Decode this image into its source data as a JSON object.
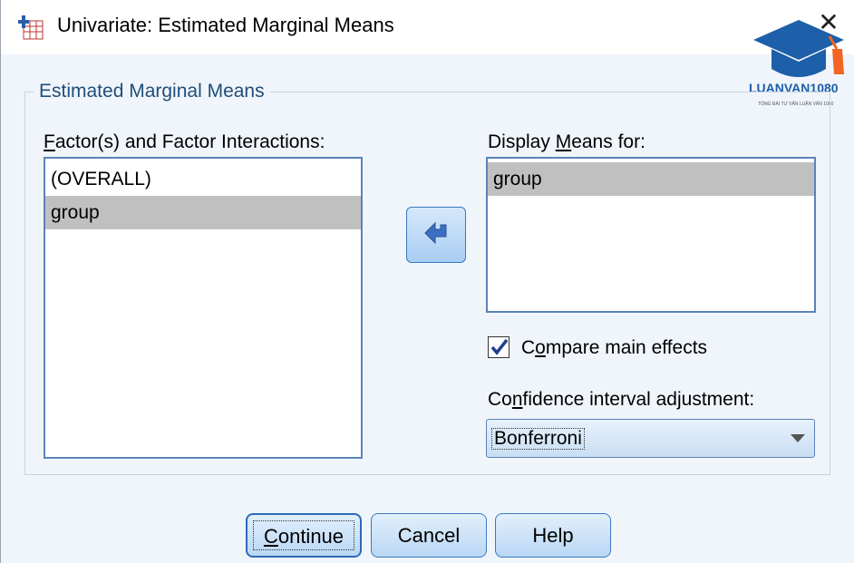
{
  "window": {
    "title": "Univariate: Estimated Marginal Means",
    "close_glyph": "✕"
  },
  "group": {
    "legend": "Estimated Marginal Means"
  },
  "factors": {
    "label_mnemonic": "F",
    "label_rest": "actor(s) and Factor Interactions:",
    "items": [
      "(OVERALL)",
      "group"
    ],
    "selected_index": 1
  },
  "display_means": {
    "label_prefix": "Display ",
    "label_mnemonic": "M",
    "label_rest": "eans for:",
    "items": [
      "group"
    ]
  },
  "move_button": {
    "icon": "arrow-left-icon"
  },
  "compare": {
    "checked": true,
    "label_prefix": "C",
    "label_mnemonic": "o",
    "label_rest": "mpare main effects"
  },
  "ci_adjustment": {
    "label_prefix": "Co",
    "label_mnemonic": "n",
    "label_rest": "fidence interval adjustment:",
    "value": "Bonferroni"
  },
  "buttons": {
    "continue_mnemonic": "C",
    "continue_rest": "ontinue",
    "cancel": "Cancel",
    "help": "Help"
  },
  "logo": {
    "brand": "LUANVAN1080",
    "tagline": "TỔNG ĐÀI TƯ VẤN LUẬN VĂN 1080"
  },
  "colors": {
    "accent": "#1f4e79",
    "selection": "#c0c0c0",
    "logo_blue": "#1d5fa8",
    "logo_orange": "#f26522"
  }
}
